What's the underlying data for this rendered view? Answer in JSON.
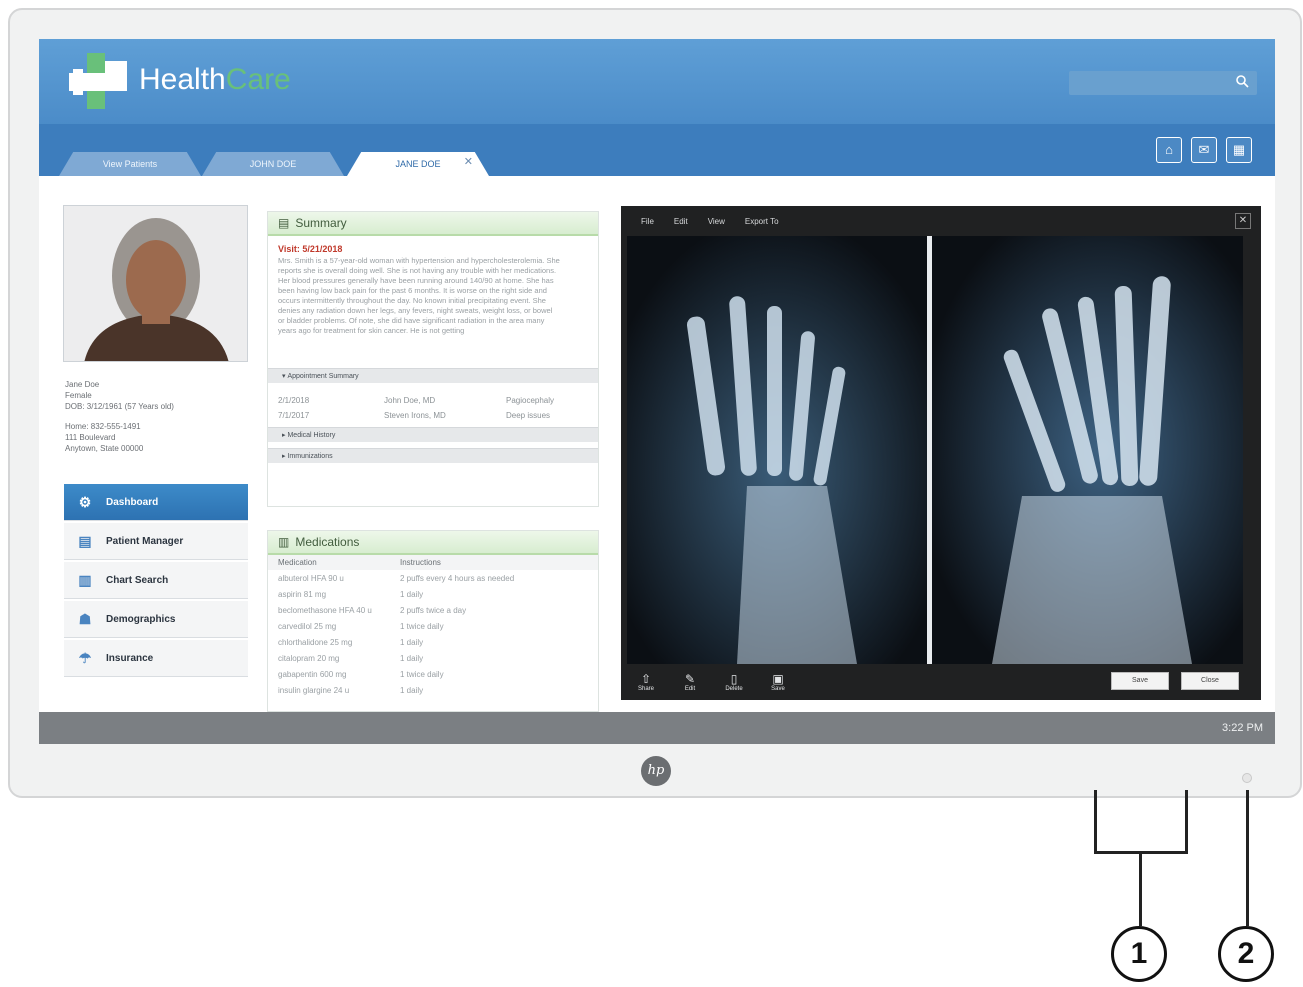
{
  "app": {
    "brand_health": "Health",
    "brand_care": "Care",
    "search_placeholder": ""
  },
  "tabs": [
    {
      "label": "View Patients"
    },
    {
      "label": "JOHN DOE"
    },
    {
      "label": "JANE DOE",
      "close": "✕"
    }
  ],
  "header_buttons": {
    "home": "⌂",
    "mail": "✉",
    "calendar": "▦"
  },
  "patient": {
    "name": "Jane Doe",
    "gender": "Female",
    "dob": "DOB: 3/12/1961 (57 Years old)",
    "phone": "Home: 832-555-1491",
    "address1": "111 Boulevard",
    "address2": "Anytown, State 00000"
  },
  "nav": [
    {
      "label": "Dashboard",
      "icon": "⚙",
      "active": true
    },
    {
      "label": "Patient Manager",
      "icon": "▤"
    },
    {
      "label": "Chart Search",
      "icon": "▥"
    },
    {
      "label": "Demographics",
      "icon": "☗"
    },
    {
      "label": "Insurance",
      "icon": "☂"
    }
  ],
  "summary": {
    "title": "Summary",
    "visit": "Visit: 5/21/2018",
    "text": "Mrs. Smith is a 57-year-old woman with hypertension and hypercholesterolemia. She reports she is overall doing well. She is not having any trouble with her medications. Her blood pressures generally have been running around 140/90 at home. She has been having low back pain for the past 6 months. It is worse on the right side and occurs intermittently throughout the day. No known initial precipitating event. She denies any radiation down her legs, any fevers, night sweats, weight loss, or bowel or bladder problems. Of note, she did have significant radiation in the area many years ago for treatment for skin cancer. He is not getting",
    "appointment_summary": "Appointment Summary",
    "appointments": [
      {
        "date": "2/1/2018",
        "doctor": "John Doe, MD",
        "reason": "Pagiocephaly"
      },
      {
        "date": "7/1/2017",
        "doctor": "Steven Irons, MD",
        "reason": "Deep issues"
      }
    ],
    "medical_history": "Medical History",
    "immunizations": "Immunizations"
  },
  "medications": {
    "title": "Medications",
    "col_med": "Medication",
    "col_inst": "Instructions",
    "rows": [
      {
        "med": "albuterol HFA 90 u",
        "inst": "2 puffs every 4 hours as needed"
      },
      {
        "med": "aspirin 81 mg",
        "inst": "1 daily"
      },
      {
        "med": "beclomethasone HFA 40 u",
        "inst": "2 puffs twice a day"
      },
      {
        "med": "carvedilol 25 mg",
        "inst": "1 twice daily"
      },
      {
        "med": "chlorthalidone 25 mg",
        "inst": "1 daily"
      },
      {
        "med": "citalopram 20 mg",
        "inst": "1 daily"
      },
      {
        "med": "gabapentin 600 mg",
        "inst": "1 twice daily"
      },
      {
        "med": "insulin glargine 24 u",
        "inst": "1 daily"
      }
    ]
  },
  "viewer": {
    "menu": [
      "File",
      "Edit",
      "View",
      "Export To"
    ],
    "close": "✕",
    "footer": [
      {
        "label": "Share",
        "icon": "⇧"
      },
      {
        "label": "Edit",
        "icon": "✎"
      },
      {
        "label": "Delete",
        "icon": "▯"
      },
      {
        "label": "Save",
        "icon": "▣"
      }
    ],
    "save_button": "Save",
    "close_button": "Close"
  },
  "taskbar": {
    "clock": "3:22 PM"
  },
  "hp_logo": "hp",
  "callouts": [
    "1",
    "2"
  ]
}
